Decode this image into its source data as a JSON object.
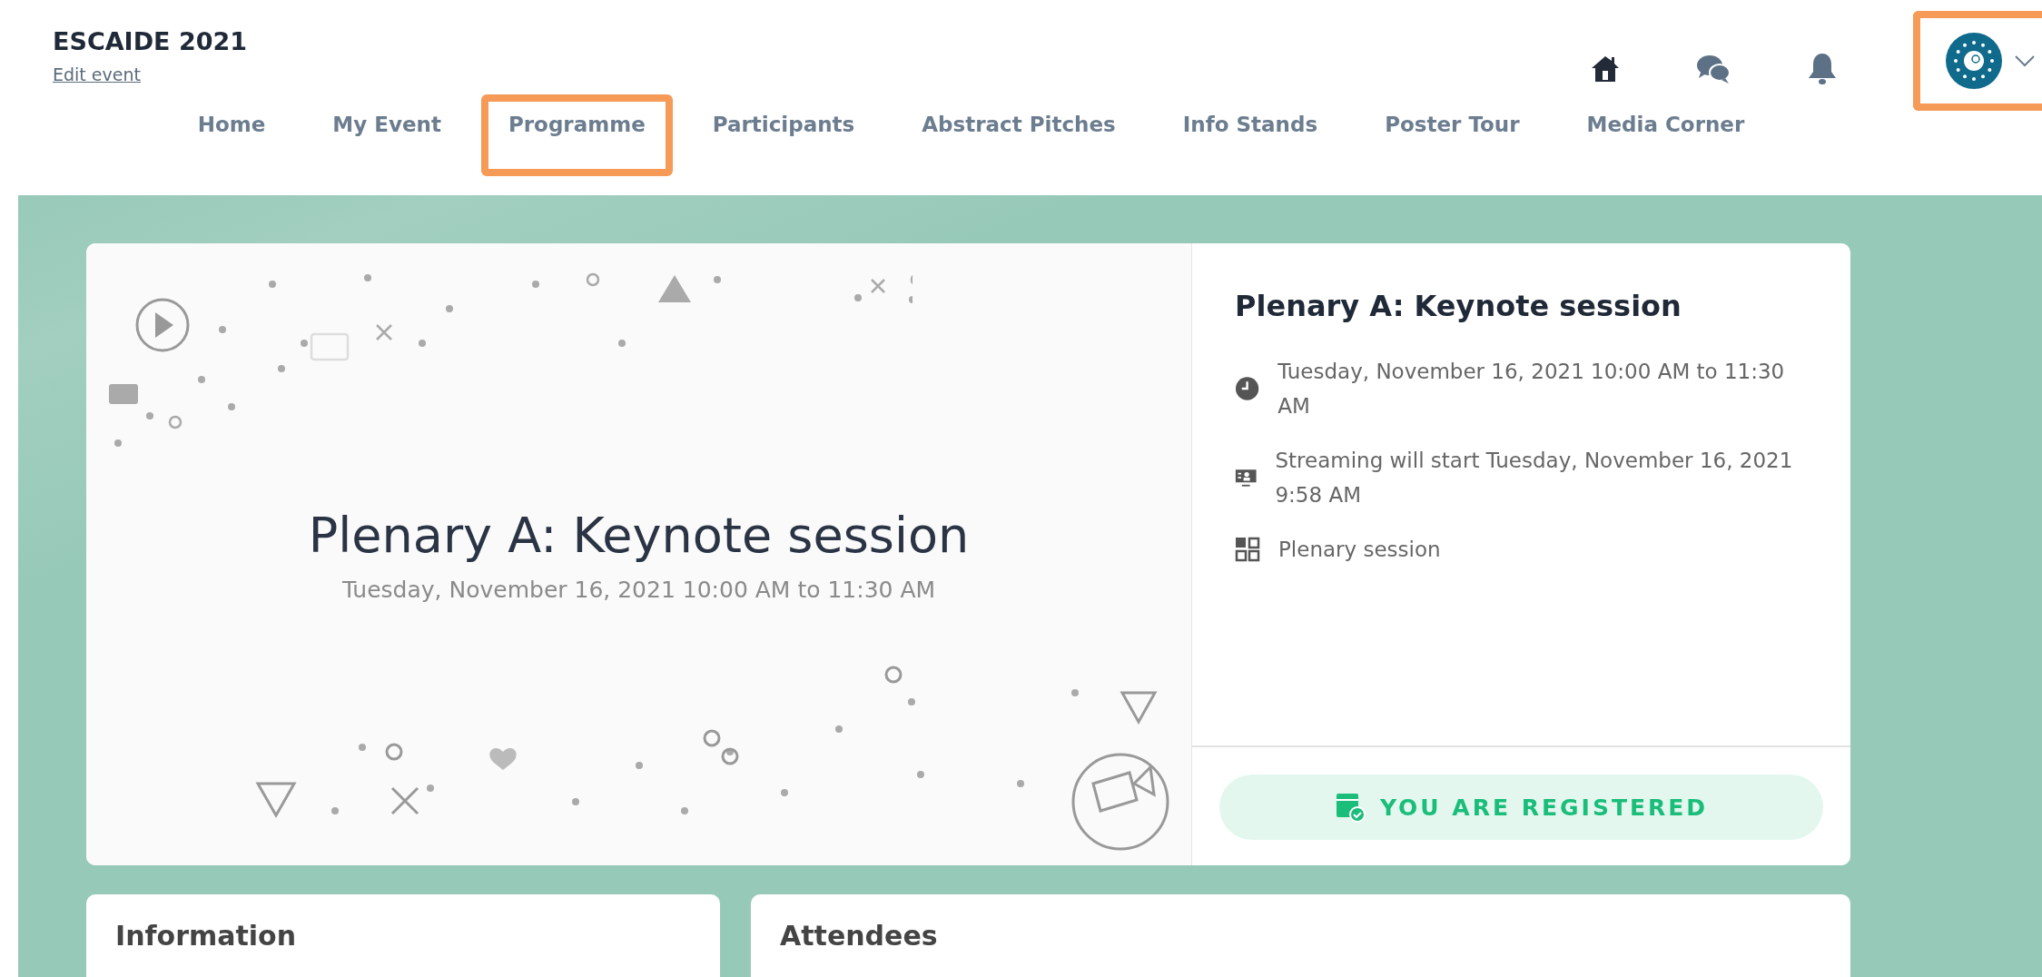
{
  "event": {
    "title": "ESCAIDE 2021",
    "edit_link": "Edit event"
  },
  "profile": {
    "highlighted": true
  },
  "nav": [
    {
      "label": "Home",
      "highlighted": false
    },
    {
      "label": "My Event",
      "highlighted": false
    },
    {
      "label": "Programme",
      "highlighted": true
    },
    {
      "label": "Participants",
      "highlighted": false
    },
    {
      "label": "Abstract Pitches",
      "highlighted": false
    },
    {
      "label": "Info Stands",
      "highlighted": false
    },
    {
      "label": "Poster Tour",
      "highlighted": false
    },
    {
      "label": "Media Corner",
      "highlighted": false
    }
  ],
  "session": {
    "banner_title": "Plenary A: Keynote session",
    "banner_date": "Tuesday, November 16, 2021 10:00 AM to 11:30 AM",
    "title": "Plenary A: Keynote session",
    "details": [
      {
        "kind": "time",
        "text": "Tuesday, November 16, 2021 10:00 AM to 11:30 AM"
      },
      {
        "kind": "stream",
        "text": "Streaming will start Tuesday, November 16, 2021 9:58 AM"
      },
      {
        "kind": "type",
        "text": "Plenary session"
      }
    ],
    "registration": {
      "label": "YOU ARE REGISTERED"
    }
  },
  "panels": [
    {
      "title": "Information"
    },
    {
      "title": "Attendees"
    }
  ]
}
